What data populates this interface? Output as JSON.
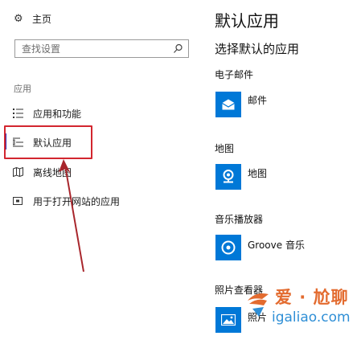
{
  "sidebar": {
    "home_label": "主页",
    "search_placeholder": "查找设置",
    "section_label": "应用",
    "items": [
      {
        "label": "应用和功能",
        "icon": "list-icon"
      },
      {
        "label": "默认应用",
        "icon": "default-apps-icon",
        "active": true
      },
      {
        "label": "离线地图",
        "icon": "offline-map-icon"
      },
      {
        "label": "用于打开网站的应用",
        "icon": "web-app-icon"
      }
    ]
  },
  "main": {
    "title": "默认应用",
    "subtitle": "选择默认的应用",
    "defaults": [
      {
        "category": "电子邮件",
        "app": "邮件",
        "icon": "mail-icon"
      },
      {
        "category": "地图",
        "app": "地图",
        "icon": "map-pin-icon"
      },
      {
        "category": "音乐播放器",
        "app": "Groove 音乐",
        "icon": "groove-icon"
      },
      {
        "category": "照片查看器",
        "app": "照片",
        "icon": "photos-icon"
      }
    ]
  },
  "watermark": {
    "line1": "爱 · 尬聊",
    "line2": "igaliao.com"
  },
  "colors": {
    "accent": "#0078d7",
    "highlight": "#d3262f",
    "arrow": "#a8262c",
    "active_bar": "#2b2bb0"
  }
}
